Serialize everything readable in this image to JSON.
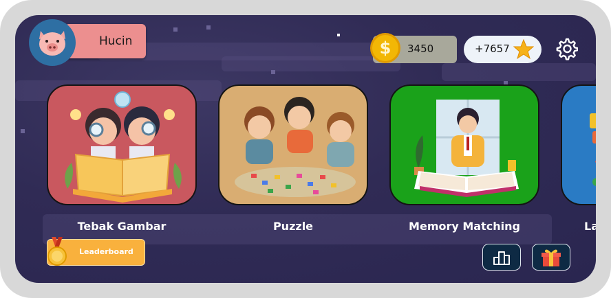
{
  "profile": {
    "username": "Hucin",
    "avatar_icon": "pig-face-icon"
  },
  "currency": {
    "coins": "3450",
    "coin_symbol": "$",
    "stars": "+7657"
  },
  "settings_icon": "gear-icon",
  "games": [
    {
      "label": "Tebak Gambar",
      "color": "#c9585f"
    },
    {
      "label": "Puzzle",
      "color": "#d9ad72"
    },
    {
      "label": "Memory Matching",
      "color": "#1aa21a"
    },
    {
      "label": "La",
      "color": "#2a7bc4"
    }
  ],
  "leaderboard": {
    "label": "Leaderboard",
    "icon": "medal-icon"
  },
  "bottom_buttons": [
    {
      "icon": "podium-chart-icon"
    },
    {
      "icon": "gift-icon"
    }
  ],
  "colors": {
    "background": "#302b55",
    "leaderboard": "#f9b13d",
    "name_pill": "#ec8f8f"
  }
}
